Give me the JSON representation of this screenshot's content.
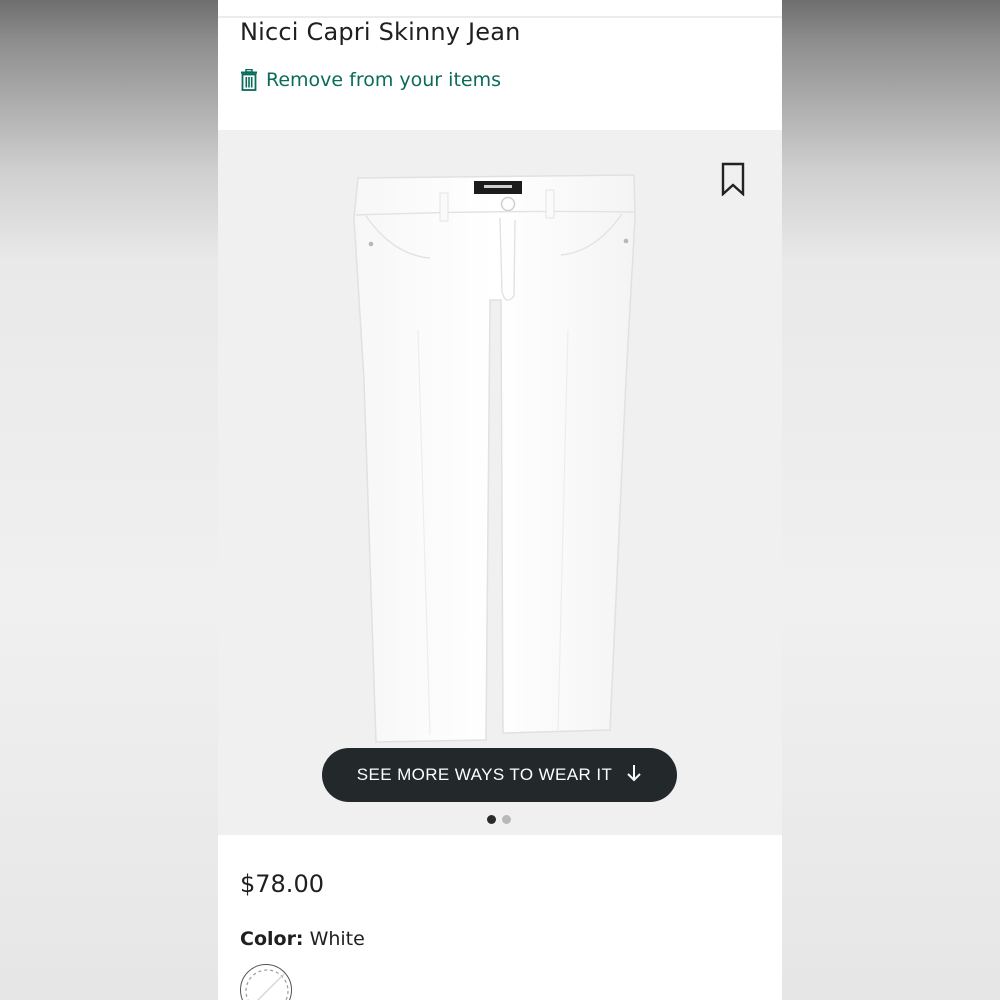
{
  "product": {
    "title": "Nicci Capri Skinny Jean",
    "remove_label": "Remove from your items",
    "price": "$78.00",
    "color_label": "Color:",
    "color_value": "White"
  },
  "gallery": {
    "see_more_label": "SEE MORE WAYS TO WEAR IT",
    "dots": [
      {
        "active": true
      },
      {
        "active": false
      }
    ],
    "background": "#f0f0f1"
  },
  "colors": {
    "accent_teal": "#0b6b5b",
    "button_dark": "#23282b"
  },
  "icons": {
    "remove": "trash-icon",
    "save": "bookmark-icon",
    "see_more": "arrow-down-icon",
    "swatch": "white-swatch"
  }
}
